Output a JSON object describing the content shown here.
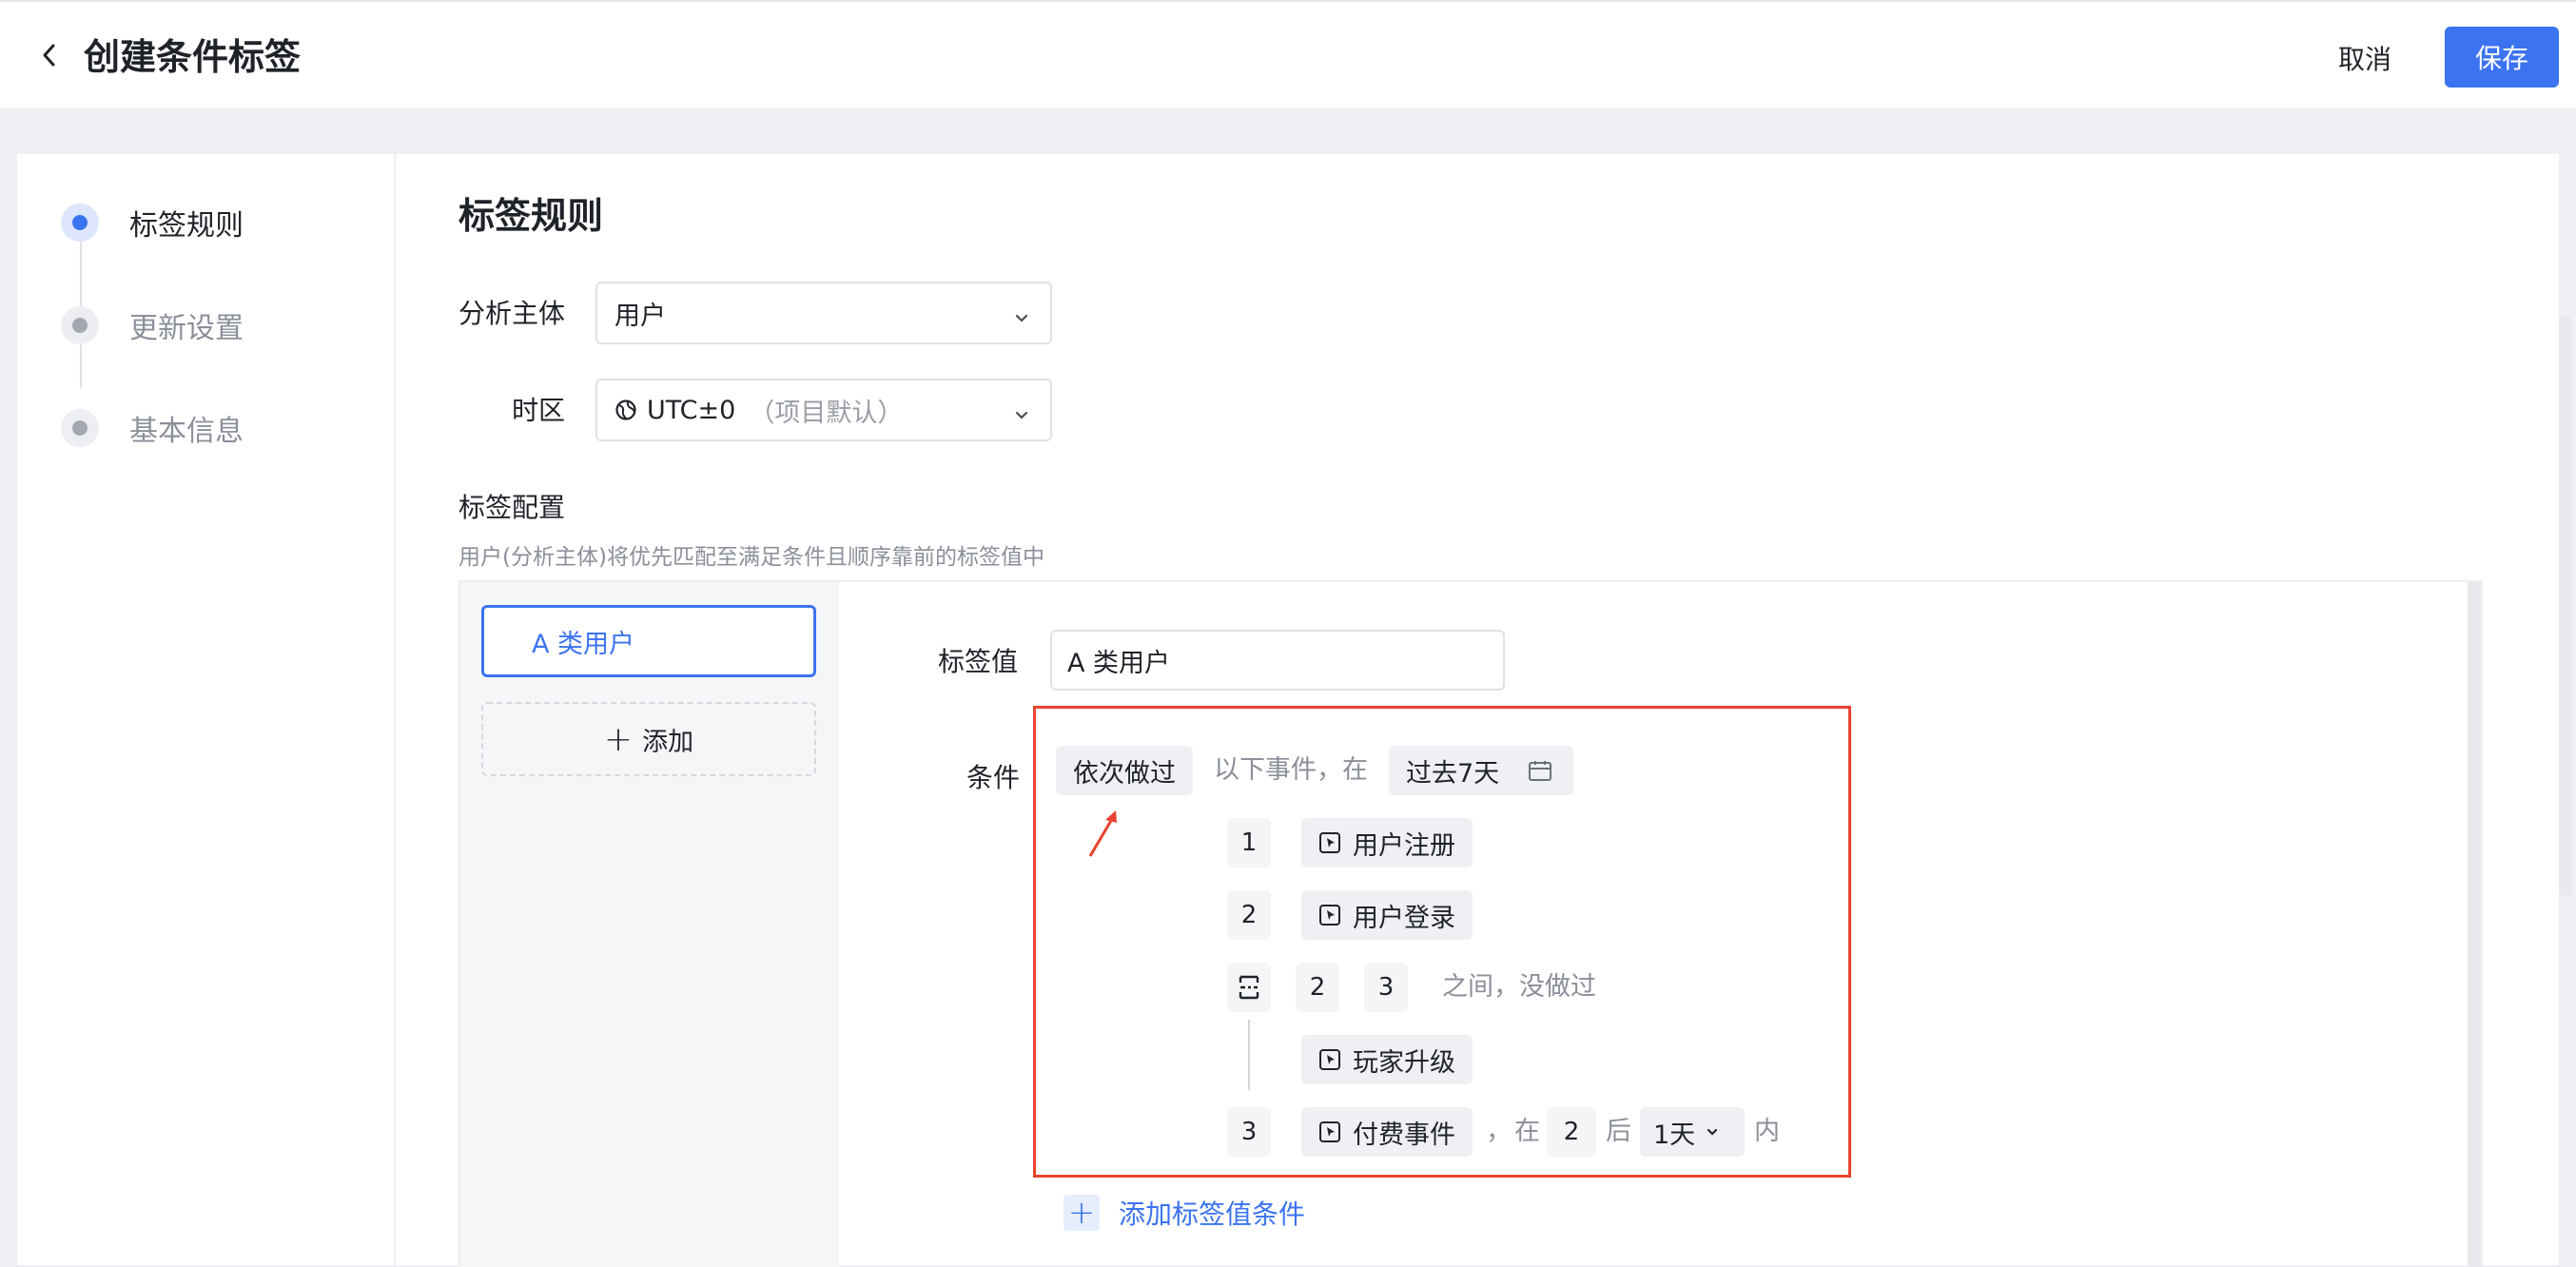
{
  "header": {
    "title": "创建条件标签",
    "cancel_label": "取消",
    "save_label": "保存"
  },
  "steps": [
    {
      "label": "标签规则",
      "active": true
    },
    {
      "label": "更新设置",
      "active": false
    },
    {
      "label": "基本信息",
      "active": false
    }
  ],
  "form": {
    "section_title": "标签规则",
    "subject_label": "分析主体",
    "subject_value": "用户",
    "timezone_label": "时区",
    "timezone_value": "UTC±0",
    "timezone_note": "（项目默认）",
    "config_title": "标签配置",
    "config_hint": "用户(分析主体)将优先匹配至满足条件且顺序靠前的标签值中"
  },
  "values": {
    "selected": "A 类用户",
    "add_label": "添加"
  },
  "condition": {
    "tag_value_label": "标签值",
    "tag_value": "A 类用户",
    "cond_label": "条件",
    "mode": "依次做过",
    "mid_text": "以下事件，在",
    "range": "过去7天",
    "events": [
      {
        "index": "1",
        "name": "用户注册"
      },
      {
        "index": "2",
        "name": "用户登录"
      }
    ],
    "exclusion": {
      "from": "2",
      "to": "3",
      "text": "之间，没做过",
      "event": "玩家升级"
    },
    "last": {
      "index": "3",
      "name": "付费事件",
      "sep": "，",
      "at": "在",
      "step": "2",
      "after": "后",
      "window": "1天",
      "within": "内"
    },
    "add_label": "添加标签值条件"
  },
  "colors": {
    "accent": "#3b73f0",
    "highlight": "#e8432f"
  }
}
